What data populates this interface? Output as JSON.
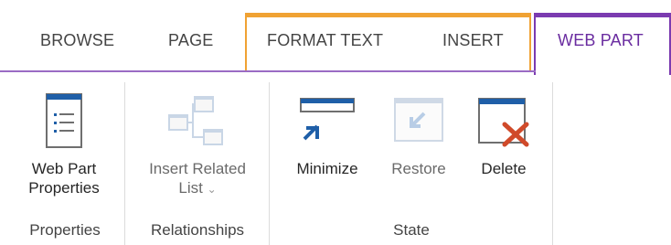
{
  "tabs": {
    "browse": "BROWSE",
    "page": "PAGE",
    "format_text": "FORMAT TEXT",
    "insert": "INSERT",
    "web_part": "WEB PART"
  },
  "ribbon": {
    "groups": {
      "properties": {
        "label": "Properties",
        "buttons": {
          "web_part_properties": {
            "line1": "Web Part",
            "line2": "Properties",
            "icon": "properties-list-icon"
          }
        }
      },
      "relationships": {
        "label": "Relationships",
        "buttons": {
          "insert_related_list": {
            "line1": "Insert Related",
            "line2": "List",
            "dropdown": "⌄",
            "icon": "related-list-icon"
          }
        }
      },
      "state": {
        "label": "State",
        "buttons": {
          "minimize": {
            "label": "Minimize",
            "icon": "minimize-icon"
          },
          "restore": {
            "label": "Restore",
            "icon": "restore-icon"
          },
          "delete": {
            "label": "Delete",
            "icon": "delete-icon"
          }
        }
      }
    }
  },
  "colors": {
    "context_group_accent": "#f0a233",
    "web_part_accent": "#7b3bb0",
    "icon_blue": "#1f5fa8",
    "delete_red": "#d04a2a"
  }
}
